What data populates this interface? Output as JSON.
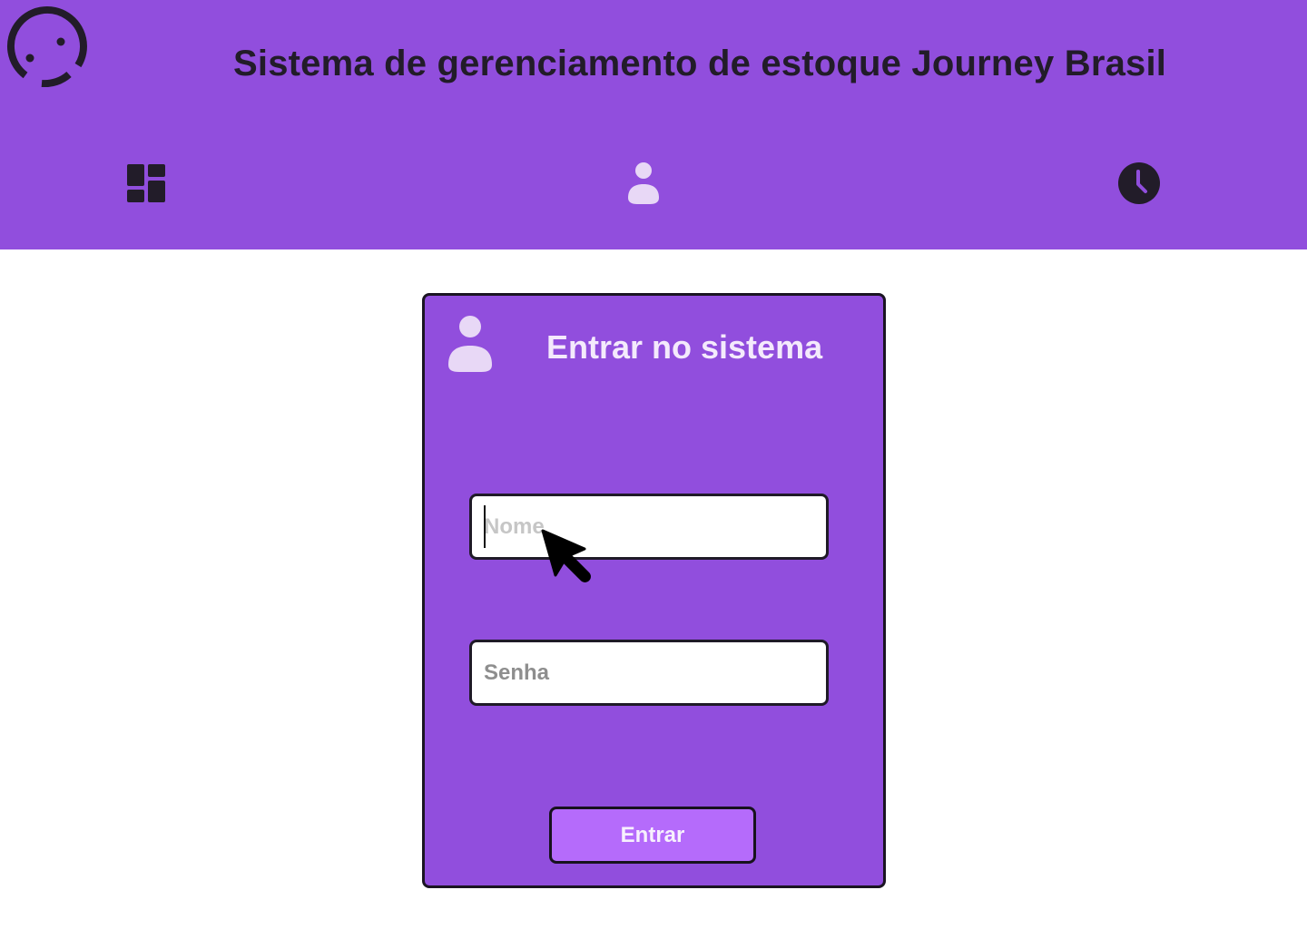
{
  "header": {
    "title": "Sistema de gerenciamento de estoque Journey Brasil",
    "logo_icon": "smiley-ring-logo-icon",
    "nav": [
      {
        "icon": "dashboard-icon",
        "active": false
      },
      {
        "icon": "user-icon",
        "active": true
      },
      {
        "icon": "clock-icon",
        "active": false
      }
    ]
  },
  "login": {
    "title": "Entrar no sistema",
    "icon": "user-icon",
    "name_placeholder": "Nome",
    "name_value": "",
    "password_placeholder": "Senha",
    "password_value": "",
    "submit_label": "Entrar"
  },
  "colors": {
    "brand_purple": "#914edd",
    "button_purple": "#b56bfb",
    "dark": "#221c29",
    "active_icon": "#e8d8f6"
  }
}
